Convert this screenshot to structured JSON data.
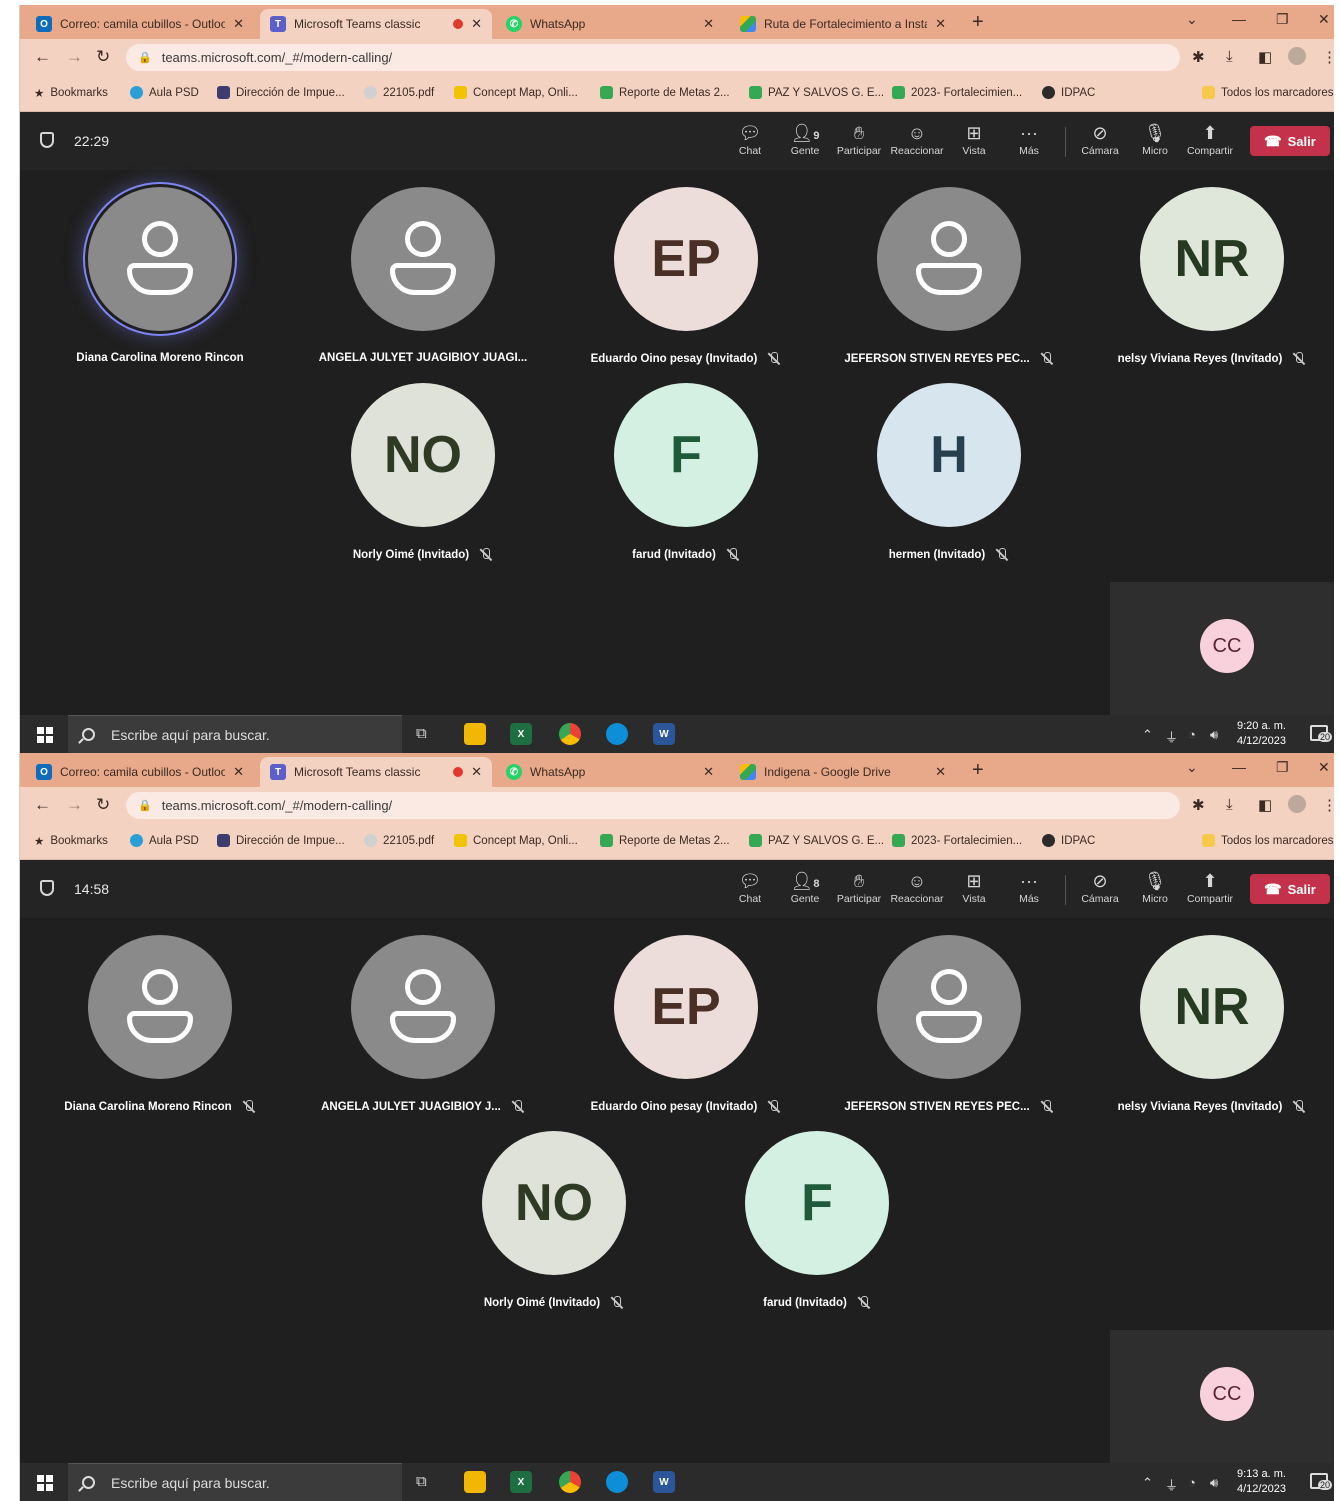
{
  "screens": [
    {
      "tabs": [
        {
          "label": "Correo: camila cubillos - Outloo",
          "icon": "outlook-icon",
          "color": "#0f6cbd"
        },
        {
          "label": "Microsoft Teams classic",
          "icon": "teams-icon",
          "color": "#5b5fc7"
        },
        {
          "label": "WhatsApp",
          "icon": "whatsapp-icon",
          "color": "#25d366"
        },
        {
          "label": "Ruta de Fortalecimiento a Instan",
          "icon": "drive-icon",
          "color": "#fbbc04"
        }
      ],
      "url": "teams.microsoft.com/_#/modern-calling/",
      "timer": "22:29",
      "people_count": "9",
      "participants": [
        {
          "name": "Diana Carolina Moreno Rincon",
          "initials": "",
          "bg": "#8a8a8a",
          "fg": "#ffffff",
          "muted": false,
          "speaking": true
        },
        {
          "name": "ANGELA JULYET JUAGIBIOY JUAGI...",
          "initials": "",
          "bg": "#8a8a8a",
          "fg": "#ffffff",
          "muted": false,
          "speaking": false
        },
        {
          "name": "Eduardo Oino pesay (Invitado)",
          "initials": "EP",
          "bg": "#ecddda",
          "fg": "#4a2f26",
          "muted": true,
          "speaking": false
        },
        {
          "name": "JEFERSON STIVEN REYES PEC...",
          "initials": "",
          "bg": "#8a8a8a",
          "fg": "#ffffff",
          "muted": true,
          "speaking": false
        },
        {
          "name": "nelsy Viviana Reyes (Invitado)",
          "initials": "NR",
          "bg": "#dfe7da",
          "fg": "#263a22",
          "muted": true,
          "speaking": false
        },
        {
          "name": "Norly Oimé (Invitado)",
          "initials": "NO",
          "bg": "#dfe2d8",
          "fg": "#2f3a25",
          "muted": true,
          "speaking": false
        },
        {
          "name": "farud (Invitado)",
          "initials": "F",
          "bg": "#d4f0e2",
          "fg": "#1f5a3a",
          "muted": true,
          "speaking": false
        },
        {
          "name": "hermen (Invitado)",
          "initials": "H",
          "bg": "#d7e6ee",
          "fg": "#26404e",
          "muted": true,
          "speaking": false
        }
      ],
      "self_initials": "CC",
      "clock_time": "9:20 a. m.",
      "clock_date": "4/12/2023"
    },
    {
      "tabs": [
        {
          "label": "Correo: camila cubillos - Outloo",
          "icon": "outlook-icon",
          "color": "#0f6cbd"
        },
        {
          "label": "Microsoft Teams classic",
          "icon": "teams-icon",
          "color": "#5b5fc7"
        },
        {
          "label": "WhatsApp",
          "icon": "whatsapp-icon",
          "color": "#25d366"
        },
        {
          "label": "Indigena - Google Drive",
          "icon": "drive-icon",
          "color": "#fbbc04"
        }
      ],
      "url": "teams.microsoft.com/_#/modern-calling/",
      "timer": "14:58",
      "people_count": "8",
      "participants": [
        {
          "name": "Diana Carolina Moreno Rincon",
          "initials": "",
          "bg": "#8a8a8a",
          "fg": "#ffffff",
          "muted": true,
          "speaking": false
        },
        {
          "name": "ANGELA JULYET JUAGIBIOY J...",
          "initials": "",
          "bg": "#8a8a8a",
          "fg": "#ffffff",
          "muted": true,
          "speaking": false
        },
        {
          "name": "Eduardo Oino pesay (Invitado)",
          "initials": "EP",
          "bg": "#ecddda",
          "fg": "#4a2f26",
          "muted": true,
          "speaking": false
        },
        {
          "name": "JEFERSON STIVEN REYES PEC...",
          "initials": "",
          "bg": "#8a8a8a",
          "fg": "#ffffff",
          "muted": true,
          "speaking": false
        },
        {
          "name": "nelsy Viviana Reyes (Invitado)",
          "initials": "NR",
          "bg": "#dfe7da",
          "fg": "#263a22",
          "muted": true,
          "speaking": false
        },
        {
          "name": "Norly Oimé (Invitado)",
          "initials": "NO",
          "bg": "#dfe2d8",
          "fg": "#2f3a25",
          "muted": true,
          "speaking": false
        },
        {
          "name": "farud (Invitado)",
          "initials": "F",
          "bg": "#d4f0e2",
          "fg": "#1f5a3a",
          "muted": true,
          "speaking": false
        }
      ],
      "self_initials": "CC",
      "clock_time": "9:13 a. m.",
      "clock_date": "4/12/2023"
    }
  ],
  "bookmarks": [
    "Bookmarks",
    "Aula PSD",
    "Dirección de Impue...",
    "22105.pdf",
    "Concept Map, Onli...",
    "Reporte de Metas 2...",
    "PAZ Y SALVOS G. E...",
    "2023- Fortalecimien...",
    "IDPAC"
  ],
  "all_bookmarks": "Todos los marcadores",
  "toolbar": {
    "chat": "Chat",
    "people": "Gente",
    "raise": "Participar",
    "react": "Reaccionar",
    "view": "Vista",
    "more": "Más",
    "camera": "Cámara",
    "mic": "Micro",
    "share": "Compartir",
    "leave": "Salir"
  },
  "taskbar": {
    "search_placeholder": "Escribe aquí para buscar.",
    "notif_count": "20"
  }
}
